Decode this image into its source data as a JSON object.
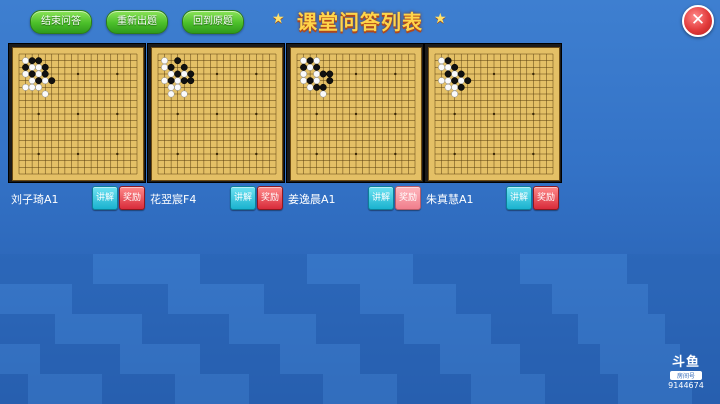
{
  "toolbar": {
    "end_qa": "结束问答",
    "reissue": "重新出题",
    "back_to_original": "回到原题"
  },
  "title": "课堂问答列表",
  "close_symbol": "✕",
  "students": [
    {
      "name": "刘子琦A1",
      "explain": "讲解",
      "reward": "奖励"
    },
    {
      "name": "花翌宸F4",
      "explain": "讲解",
      "reward": "奖励"
    },
    {
      "name": "姜逸晨A1",
      "explain": "讲解",
      "reward": "奖励"
    },
    {
      "name": "朱真慧A1",
      "explain": "讲解",
      "reward": "奖励"
    }
  ],
  "boards": [
    {
      "black": [
        [
          2,
          1
        ],
        [
          3,
          1
        ],
        [
          1,
          2
        ],
        [
          4,
          2
        ],
        [
          2,
          3
        ],
        [
          4,
          3
        ],
        [
          3,
          4
        ],
        [
          5,
          4
        ]
      ],
      "white": [
        [
          1,
          1
        ],
        [
          2,
          2
        ],
        [
          3,
          2
        ],
        [
          1,
          3
        ],
        [
          3,
          3
        ],
        [
          2,
          4
        ],
        [
          4,
          4
        ],
        [
          1,
          5
        ],
        [
          2,
          5
        ],
        [
          3,
          5
        ],
        [
          4,
          6
        ]
      ]
    },
    {
      "black": [
        [
          3,
          1
        ],
        [
          2,
          2
        ],
        [
          4,
          2
        ],
        [
          3,
          3
        ],
        [
          5,
          3
        ],
        [
          2,
          4
        ],
        [
          4,
          4
        ],
        [
          5,
          4
        ]
      ],
      "white": [
        [
          1,
          1
        ],
        [
          1,
          2
        ],
        [
          2,
          3
        ],
        [
          4,
          3
        ],
        [
          1,
          4
        ],
        [
          3,
          4
        ],
        [
          2,
          5
        ],
        [
          3,
          5
        ],
        [
          2,
          6
        ],
        [
          4,
          6
        ]
      ]
    },
    {
      "black": [
        [
          2,
          1
        ],
        [
          1,
          2
        ],
        [
          3,
          2
        ],
        [
          4,
          3
        ],
        [
          5,
          3
        ],
        [
          2,
          4
        ],
        [
          5,
          4
        ],
        [
          3,
          5
        ],
        [
          4,
          5
        ]
      ],
      "white": [
        [
          1,
          1
        ],
        [
          3,
          1
        ],
        [
          2,
          2
        ],
        [
          1,
          3
        ],
        [
          3,
          3
        ],
        [
          1,
          4
        ],
        [
          3,
          4
        ],
        [
          2,
          5
        ],
        [
          4,
          6
        ]
      ]
    },
    {
      "black": [
        [
          2,
          1
        ],
        [
          3,
          2
        ],
        [
          2,
          3
        ],
        [
          4,
          3
        ],
        [
          3,
          4
        ],
        [
          5,
          4
        ],
        [
          4,
          5
        ]
      ],
      "white": [
        [
          1,
          1
        ],
        [
          1,
          2
        ],
        [
          2,
          2
        ],
        [
          3,
          3
        ],
        [
          1,
          4
        ],
        [
          2,
          4
        ],
        [
          4,
          4
        ],
        [
          2,
          5
        ],
        [
          3,
          5
        ],
        [
          3,
          6
        ]
      ]
    }
  ],
  "watermark": {
    "logo": "斗鱼",
    "sub": "房间号",
    "room": "9144674"
  }
}
